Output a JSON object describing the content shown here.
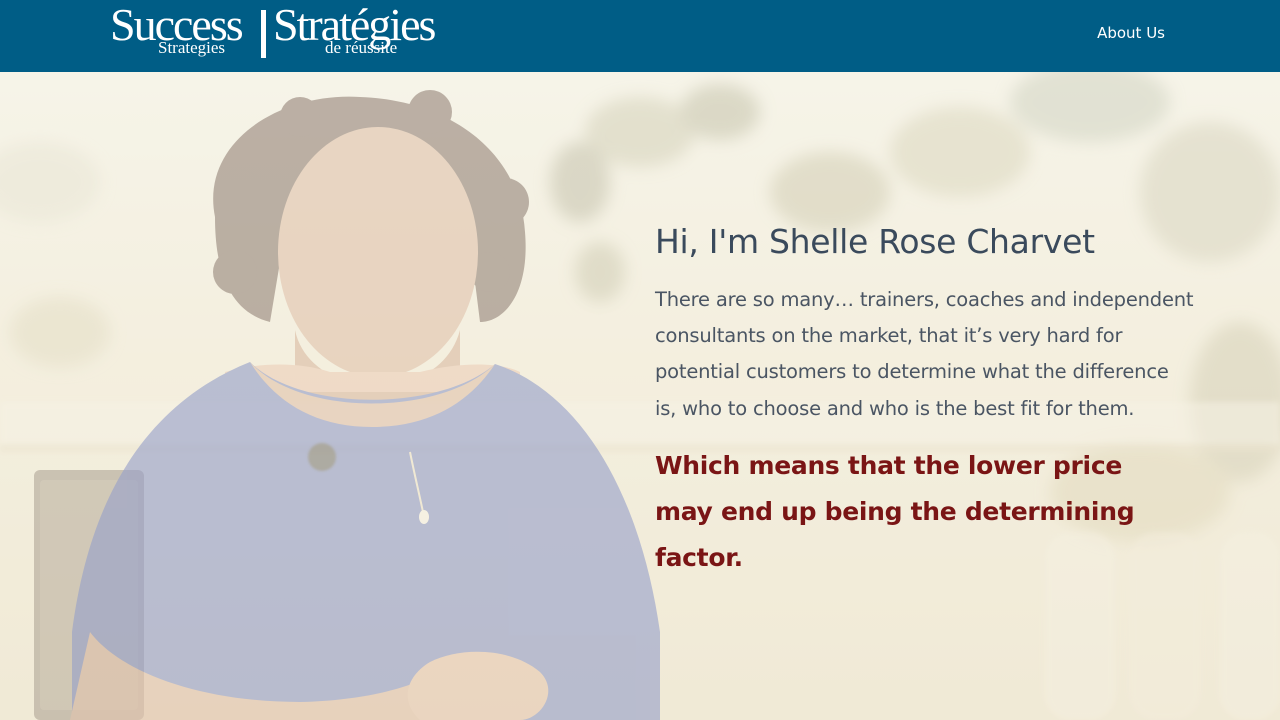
{
  "header": {
    "logo": {
      "en_big": "Success",
      "en_small": "Strategies",
      "fr_big": "Stratégies",
      "fr_small": "de réussite"
    },
    "nav": {
      "about_label": "About Us"
    }
  },
  "hero": {
    "photo_subject": "woman-portrait",
    "title": "Hi, I'm Shelle Rose Charvet",
    "body": "There are so many… trainers, coaches and independent consultants on the market, that it’s very hard for potential customers to determine what the difference is, who to choose and who is the best fit for them.",
    "emphasis": "Which means that the lower price may end up being the determining factor."
  },
  "colors": {
    "header_bg": "#005d86",
    "title_text": "#3a4a5c",
    "body_text": "#4a5563",
    "emphasis_text": "#7a1515"
  }
}
